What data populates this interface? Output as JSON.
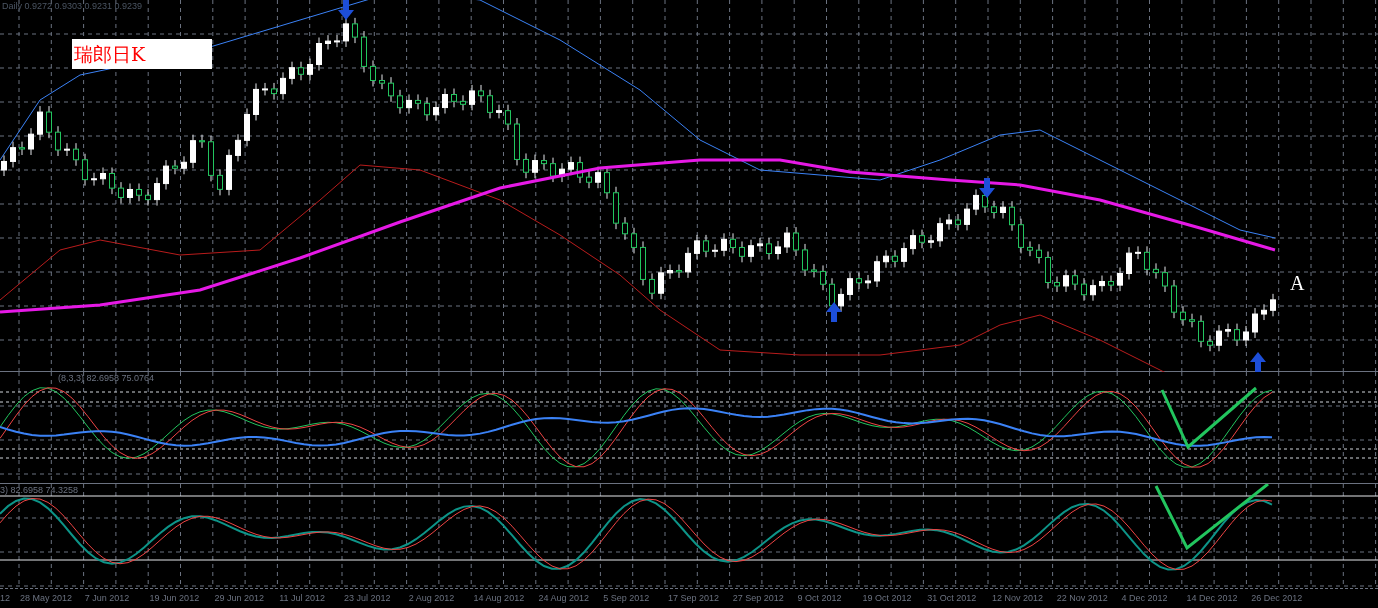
{
  "chart": {
    "header": "Daily 0.9272 0.9303 0.9231 0.9239",
    "title_label": "瑞郎日K",
    "marker_label": "A"
  },
  "indicator_1": {
    "label": "(8,3,3) 82.6958 75.0764"
  },
  "indicator_2": {
    "label": "3) 82.6958 74.3258"
  },
  "time_axis": {
    "labels": [
      "12",
      "28 May 2012",
      "7 Jun 2012",
      "19 Jun 2012",
      "29 Jun 2012",
      "11 Jul 2012",
      "23 Jul 2012",
      "2 Aug 2012",
      "14 Aug 2012",
      "24 Aug 2012",
      "5 Sep 2012",
      "17 Sep 2012",
      "27 Sep 2012",
      "9 Oct 2012",
      "19 Oct 2012",
      "31 Oct 2012",
      "12 Nov 2012",
      "22 Nov 2012",
      "4 Dec 2012",
      "14 Dec 2012",
      "26 Dec 2012"
    ]
  }
}
